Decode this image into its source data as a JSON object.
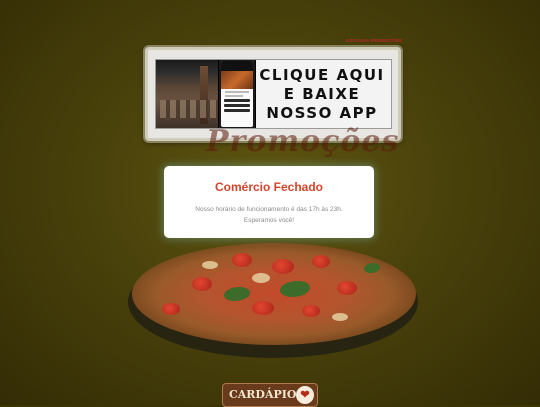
{
  "promo_link": "ESCOLHA PROMOÇÕES",
  "banner": {
    "cta_lines": [
      "CLIQUE AQUI",
      "E BAIXE",
      "NOSSO APP"
    ]
  },
  "background_script": "Promoções",
  "modal": {
    "title": "Comércio Fechado",
    "message_line1": "Nosso horário de funcionamento é das 17h às 23h.",
    "message_line2": "Esperamos você!"
  },
  "footer": {
    "logo_text": "CARDÁPIO",
    "logo_icon": "pin-icon"
  },
  "colors": {
    "modal_title": "#d2442b",
    "background": "#4a420b"
  }
}
